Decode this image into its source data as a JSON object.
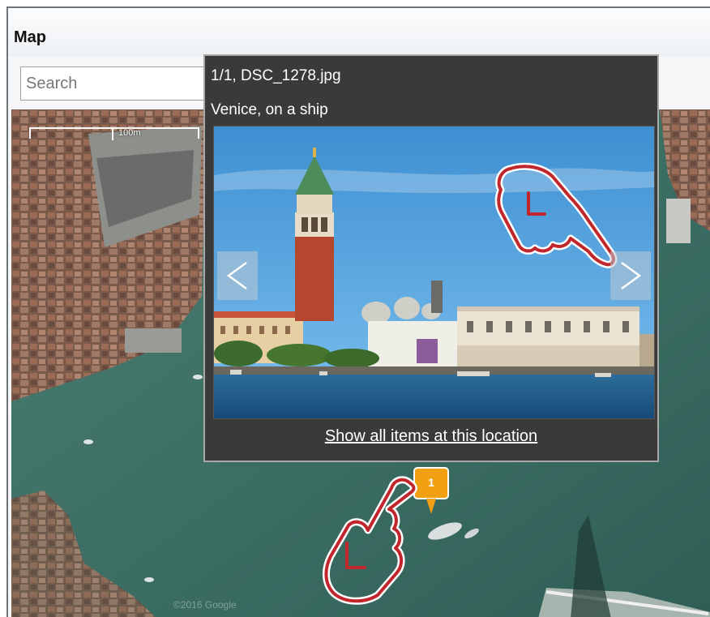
{
  "window": {
    "title": "Map"
  },
  "search": {
    "placeholder": "Search",
    "value": ""
  },
  "map": {
    "scale_label": "100m",
    "watermark": "©2016 Google"
  },
  "popup": {
    "counter": "1/1, DSC_1278.jpg",
    "caption": "Venice, on a ship",
    "prev_glyph": "<",
    "next_glyph": ">",
    "show_all_link": "Show all items at this location"
  },
  "marker": {
    "count": "1",
    "color": "#f0a012"
  },
  "icons": {
    "touch_hand": "touch-hand-icon",
    "prev": "chevron-left-icon",
    "next": "chevron-right-icon"
  }
}
